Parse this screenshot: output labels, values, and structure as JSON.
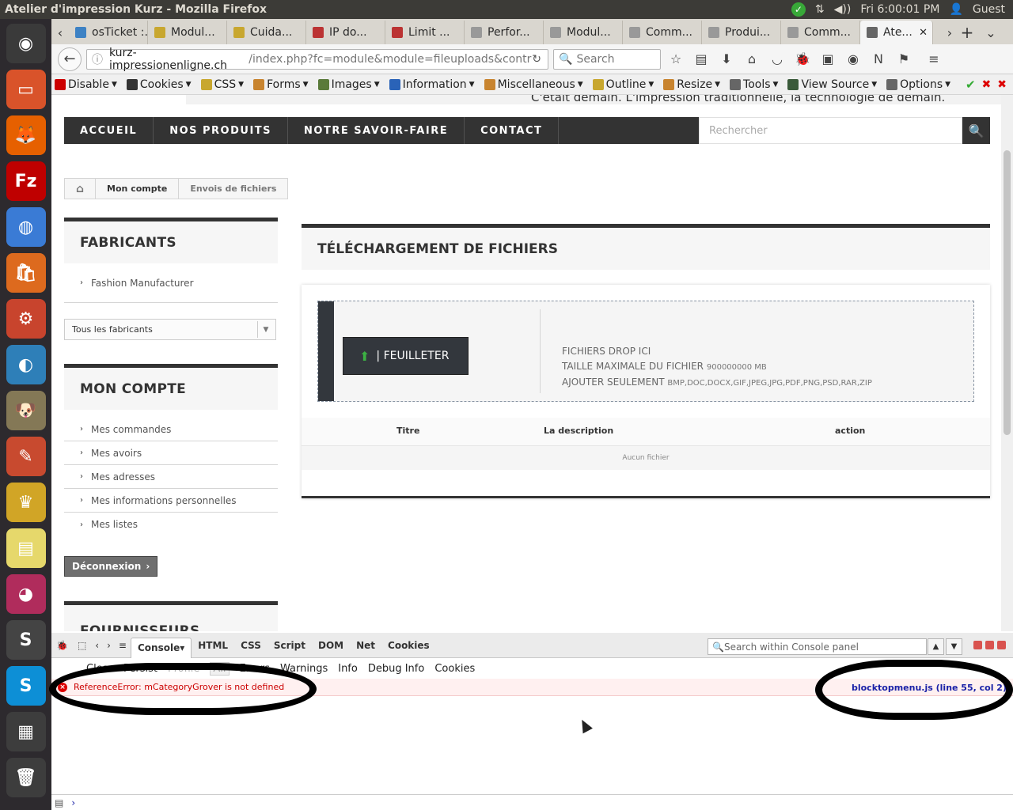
{
  "window": {
    "title": "Atelier d'impression Kurz - Mozilla Firefox"
  },
  "system": {
    "clock": "Fri 6:00:01 PM",
    "user": "Guest"
  },
  "launcher": [
    {
      "name": "ubuntu-dash-icon",
      "bg": "#3a3a3a",
      "glyph": "◉"
    },
    {
      "name": "files-icon",
      "bg": "#d9532a",
      "glyph": "▭"
    },
    {
      "name": "firefox-icon",
      "bg": "#e66000",
      "glyph": "🦊"
    },
    {
      "name": "filezilla-icon",
      "bg": "#bf0000",
      "glyph": "Fz"
    },
    {
      "name": "chrome-icon",
      "bg": "#3a7bd5",
      "glyph": "◍"
    },
    {
      "name": "software-center-icon",
      "bg": "#dd6a1e",
      "glyph": "🛍"
    },
    {
      "name": "settings-icon",
      "bg": "#c8442d",
      "glyph": "⚙"
    },
    {
      "name": "remmina-icon",
      "bg": "#2e7fb8",
      "glyph": "◐"
    },
    {
      "name": "gimp-icon",
      "bg": "#847856",
      "glyph": "🐶"
    },
    {
      "name": "paint-icon",
      "bg": "#c84a2f",
      "glyph": "✎"
    },
    {
      "name": "genie-icon",
      "bg": "#d1a526",
      "glyph": "♛"
    },
    {
      "name": "notes-icon",
      "bg": "#e6d86b",
      "glyph": "▤"
    },
    {
      "name": "pidgin-icon",
      "bg": "#b02c5c",
      "glyph": "◕"
    },
    {
      "name": "sublime-icon",
      "bg": "#444",
      "glyph": "S"
    },
    {
      "name": "skype-icon",
      "bg": "#0d8fd6",
      "glyph": "S"
    },
    {
      "name": "workspace-icon",
      "bg": "#3d3d3d",
      "glyph": "▦"
    },
    {
      "name": "trash-icon",
      "bg": "#3d3d3d",
      "glyph": "🗑"
    }
  ],
  "tabs": [
    {
      "label": "osTicket :...",
      "fav": "#3d82c4"
    },
    {
      "label": "Modul...",
      "fav": "#c8a72f"
    },
    {
      "label": "Cuida...",
      "fav": "#c8a72f"
    },
    {
      "label": "IP do...",
      "fav": "#b33"
    },
    {
      "label": "Limit ...",
      "fav": "#b33"
    },
    {
      "label": "Perfor...",
      "fav": "#999"
    },
    {
      "label": "Modul...",
      "fav": "#999"
    },
    {
      "label": "Comm...",
      "fav": "#999"
    },
    {
      "label": "Produi...",
      "fav": "#999"
    },
    {
      "label": "Comm...",
      "fav": "#999"
    },
    {
      "label": "Ate...",
      "fav": "#666",
      "active": true
    }
  ],
  "nav": {
    "url_host": "kurz-impressionenligne.ch",
    "url_path": "/index.php?fc=module&module=fileuploads&controll",
    "search_placeholder": "Search"
  },
  "devtoolbar": [
    {
      "label": "Disable",
      "color": "#c00"
    },
    {
      "label": "Cookies",
      "color": "#333"
    },
    {
      "label": "CSS",
      "color": "#c8a72f"
    },
    {
      "label": "Forms",
      "color": "#c8842f"
    },
    {
      "label": "Images",
      "color": "#5a7a3a"
    },
    {
      "label": "Information",
      "color": "#2a63b8"
    },
    {
      "label": "Miscellaneous",
      "color": "#c8842f"
    },
    {
      "label": "Outline",
      "color": "#c8a72f"
    },
    {
      "label": "Resize",
      "color": "#c8842f"
    },
    {
      "label": "Tools",
      "color": "#666"
    },
    {
      "label": "View Source",
      "color": "#3a5a3a"
    },
    {
      "label": "Options",
      "color": "#666"
    }
  ],
  "site": {
    "tagline": "C'était demain. L'impression traditionnelle, la technologie de demain.",
    "menu": [
      "ACCUEIL",
      "NOS PRODUITS",
      "NOTRE SAVOIR-FAIRE",
      "CONTACT"
    ],
    "search_placeholder": "Rechercher",
    "breadcrumb": [
      "Mon compte",
      "Envois de fichiers"
    ],
    "fabricants": {
      "title": "FABRICANTS",
      "items": [
        "Fashion Manufacturer"
      ],
      "select": "Tous les fabricants"
    },
    "compte": {
      "title": "MON COMPTE",
      "items": [
        "Mes commandes",
        "Mes avoirs",
        "Mes adresses",
        "Mes informations personnelles",
        "Mes listes"
      ]
    },
    "logout": "Déconnexion",
    "fournisseurs": "FOURNISSEURS",
    "page_title": "TÉLÉCHARGEMENT DE FICHIERS",
    "upload": {
      "button": "| FEUILLETER",
      "drop": "FICHIERS DROP ICI",
      "max_label": "TAILLE MAXIMALE DU FICHIER",
      "max_value": "900000000 MB",
      "only_label": "AJOUTER SEULEMENT",
      "only_value": "BMP,DOC,DOCX,GIF,JPEG,JPG,PDF,PNG,PSD,RAR,ZIP"
    },
    "table": {
      "cols": [
        "Titre",
        "La description",
        "action"
      ],
      "empty": "Aucun fichier"
    }
  },
  "console": {
    "tabs": [
      "Console",
      "HTML",
      "CSS",
      "Script",
      "DOM",
      "Net",
      "Cookies"
    ],
    "search_placeholder": "Search within Console panel",
    "filters": [
      "Clear",
      "Persist",
      "Profile",
      "All",
      "Errors",
      "Warnings",
      "Info",
      "Debug Info",
      "Cookies"
    ],
    "error": "ReferenceError: mCategoryGrover is not defined",
    "source": "blocktopmenu.js (line 55, col 2)"
  }
}
